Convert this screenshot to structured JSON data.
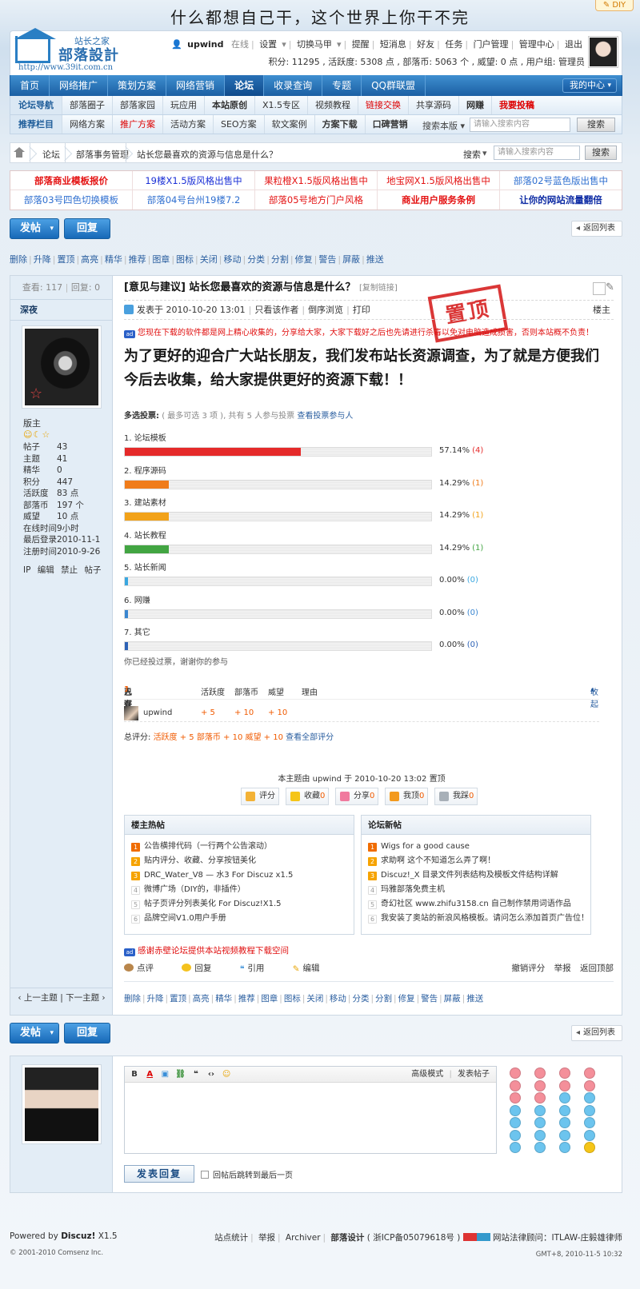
{
  "topbar": {
    "slogan": "什么都想自己干，这个世界上你干不完",
    "diy": "✎ DIY"
  },
  "header": {
    "brand_sub": "站长之家",
    "brand": "部落設計",
    "url": "http://www.39it.com.cn",
    "user": {
      "name": "upwind",
      "status": "在线"
    },
    "nav": [
      "设置",
      "切换马甲",
      "提醒",
      "短消息",
      "好友",
      "任务",
      "门户管理",
      "管理中心",
      "退出"
    ],
    "stats": "积分: 11295 , 活跃度: 5308 点 , 部落币: 5063 个 , 威望: 0 点 , 用户组: 管理员"
  },
  "mainnav": {
    "items": [
      "首页",
      "网络推广",
      "策划方案",
      "网络营销",
      "论坛",
      "收录查询",
      "专题",
      "QQ群联盟"
    ],
    "active": "论坛",
    "my_center": "我的中心"
  },
  "subnav1": {
    "lead": "论坛导航",
    "items": [
      "部落圈子",
      "部落家园",
      "玩应用",
      "本站原创",
      "X1.5专区",
      "视频教程",
      "链接交换",
      "共享源码",
      "网赚",
      "我要投稿"
    ]
  },
  "subnav2": {
    "lead": "推荐栏目",
    "items": [
      "网络方案",
      "推广方案",
      "活动方案",
      "SEO方案",
      "软文案例",
      "方案下载",
      "口碑营销"
    ],
    "search_scope": "搜索本版",
    "search_placeholder": "请输入搜索内容",
    "search_btn": "搜索"
  },
  "breadcrumb": {
    "items": [
      "论坛",
      "部落事务管理",
      "站长您最喜欢的资源与信息是什么？"
    ],
    "search_label": "搜索",
    "search_placeholder": "请输入搜索内容",
    "search_btn": "搜索"
  },
  "ads": [
    [
      "部落商业模板报价",
      "19楼X1.5版风格出售中",
      "果粒橙X1.5版风格出售中",
      "地宝网X1.5版风格出售中",
      "部落02号蓝色版出售中"
    ],
    [
      "部落03号四色切换模板",
      "部落04号台州19楼7.2",
      "部落05号地方门户风格",
      "商业用户服务条例",
      "让你的网站流量翻倍"
    ]
  ],
  "buttons": {
    "post": "发帖",
    "reply": "回复",
    "back": "返回列表"
  },
  "modbar": [
    "删除",
    "升降",
    "置顶",
    "高亮",
    "精华",
    "推荐",
    "图章",
    "图标",
    "关闭",
    "移动",
    "分类",
    "分割",
    "修复",
    "警告",
    "屏蔽",
    "推送"
  ],
  "thread": {
    "views_label": "查看:",
    "views": "117",
    "replies_label": "回复:",
    "replies": "0",
    "title": "[意见与建议] 站长您最喜欢的资源与信息是什么？",
    "copy_link": "[复制链接]",
    "stamp": "置顶",
    "meta": {
      "posted": "发表于 2010-10-20 13:01",
      "author_only": "只看该作者",
      "reverse": "倒序浏览",
      "print": "打印"
    },
    "floor": "楼主",
    "notice": "您现在下载的软件都是网上精心收集的，分享给大家，大家下载好之后也先请进行杀毒以免对电脑造成损害，否则本站概不负责！",
    "headline": "为了更好的迎合广大站长朋友，我们发布站长资源调查，为了就是方便我们今后去收集，给大家提供更好的资源下载！！",
    "poll": {
      "head_a": "多选投票:",
      "head_b": "( 最多可选 3 项 ), 共有 5 人参与投票",
      "view_link": "查看投票参与人",
      "options": [
        {
          "label": "1.  论坛模板",
          "pct": "57.14%",
          "count": "(4)",
          "value": 57.14,
          "color": "#e52a2a"
        },
        {
          "label": "2.  程序源码",
          "pct": "14.29%",
          "count": "(1)",
          "value": 14.29,
          "color": "#f07c1a"
        },
        {
          "label": "3.  建站素材",
          "pct": "14.29%",
          "count": "(1)",
          "value": 14.29,
          "color": "#f2a219"
        },
        {
          "label": "4.  站长教程",
          "pct": "14.29%",
          "count": "(1)",
          "value": 14.29,
          "color": "#42a542"
        },
        {
          "label": "5.  站长新闻",
          "pct": "0.00%",
          "count": "(0)",
          "value": 0,
          "color": "#3aa7e0"
        },
        {
          "label": "6.  网赚",
          "pct": "0.00%",
          "count": "(0)",
          "value": 0,
          "color": "#3a86d0"
        },
        {
          "label": "7.  其它",
          "pct": "0.00%",
          "count": "(0)",
          "value": 0,
          "color": "#2d62b6"
        }
      ],
      "voted": "你已经投过票，谢谢你的参与"
    },
    "rating": {
      "head_a": "已有",
      "head_n": "1",
      "head_b": "人评分",
      "cols": [
        "活跃度",
        "部落币",
        "威望",
        "理由"
      ],
      "collapse": "收起",
      "rows": [
        {
          "user": "upwind",
          "a": "+ 5",
          "b": "+ 10",
          "c": "+ 10"
        }
      ],
      "total_label": "总评分:",
      "total": "活跃度 + 5  部落币 + 10  威望 + 10",
      "view_all": "查看全部评分"
    },
    "set_by": "本主题由 upwind 于 2010-10-20 13:02 置顶",
    "actions": [
      {
        "label": "评分",
        "n": ""
      },
      {
        "label": "收藏",
        "n": "0"
      },
      {
        "label": "分享",
        "n": "0"
      },
      {
        "label": "我顶",
        "n": "0"
      },
      {
        "label": "我踩",
        "n": "0"
      }
    ],
    "hot_title": "楼主热帖",
    "hot": [
      "公告横排代码（一行两个公告滚动）",
      "贴内评分、收藏、分享按钮美化",
      "DRC_Water_V8 — 水3 For Discuz x1.5",
      "微博广场（DIY的，非插件）",
      "帖子页评分列表美化 For Discuz!X1.5",
      "品牌空间V1.0用户手册"
    ],
    "new_title": "论坛新帖",
    "new": [
      "Wigs for a good cause",
      "求助啊 这个不知道怎么弄了啊！",
      "Discuz!_X 目录文件列表结构及模板文件结构详解",
      "玛雅部落免费主机",
      "奇幻社区 www.zhifu3158.cn 自己制作禁用词语作品",
      "我安装了奥站的新浪风格模板。请问怎么添加首页广告位！"
    ],
    "thanks": "感谢赤壁论坛提供本站视频教程下载空间",
    "foot_left": [
      "点评",
      "回复",
      "引用",
      "编辑"
    ],
    "foot_right": [
      "撤销评分",
      "举报",
      "返回顶部"
    ],
    "prev_next": "‹ 上一主题 | 下一主题 ›"
  },
  "author": {
    "name": "深夜",
    "group": "版主",
    "stars": "☺☾☆",
    "stats": [
      [
        "帖子",
        "43"
      ],
      [
        "主题",
        "41"
      ],
      [
        "精华",
        "0"
      ],
      [
        "积分",
        "447"
      ],
      [
        "活跃度",
        "83 点"
      ],
      [
        "部落币",
        "197 个"
      ],
      [
        "威望",
        "10 点"
      ],
      [
        "在线时间",
        "9小时"
      ],
      [
        "最后登录",
        "2010-11-1"
      ],
      [
        "注册时间",
        "2010-9-26"
      ]
    ],
    "links": [
      "IP",
      "编辑",
      "禁止",
      "帖子"
    ]
  },
  "editor": {
    "advanced": "高级模式",
    "post_thread": "发表帖子",
    "submit": "发表回复",
    "jump": "回帖后跳转到最后一页"
  },
  "footer": {
    "powered_a": "Powered by",
    "powered_b": "Discuz!",
    "powered_c": "X1.5",
    "copyright": "© 2001-2010 Comsenz Inc.",
    "links": [
      "站点统计",
      "举报",
      "Archiver",
      "部落设计",
      "( 浙ICP备05079618号 )",
      "网站法律顾问：ITLAW-庄毅雄律师"
    ],
    "gmt": "GMT+8, 2010-11-5 10:32"
  },
  "colors": {
    "accent": "#1b5fa3",
    "red": "#e41313",
    "link": "#2b5fa0"
  }
}
